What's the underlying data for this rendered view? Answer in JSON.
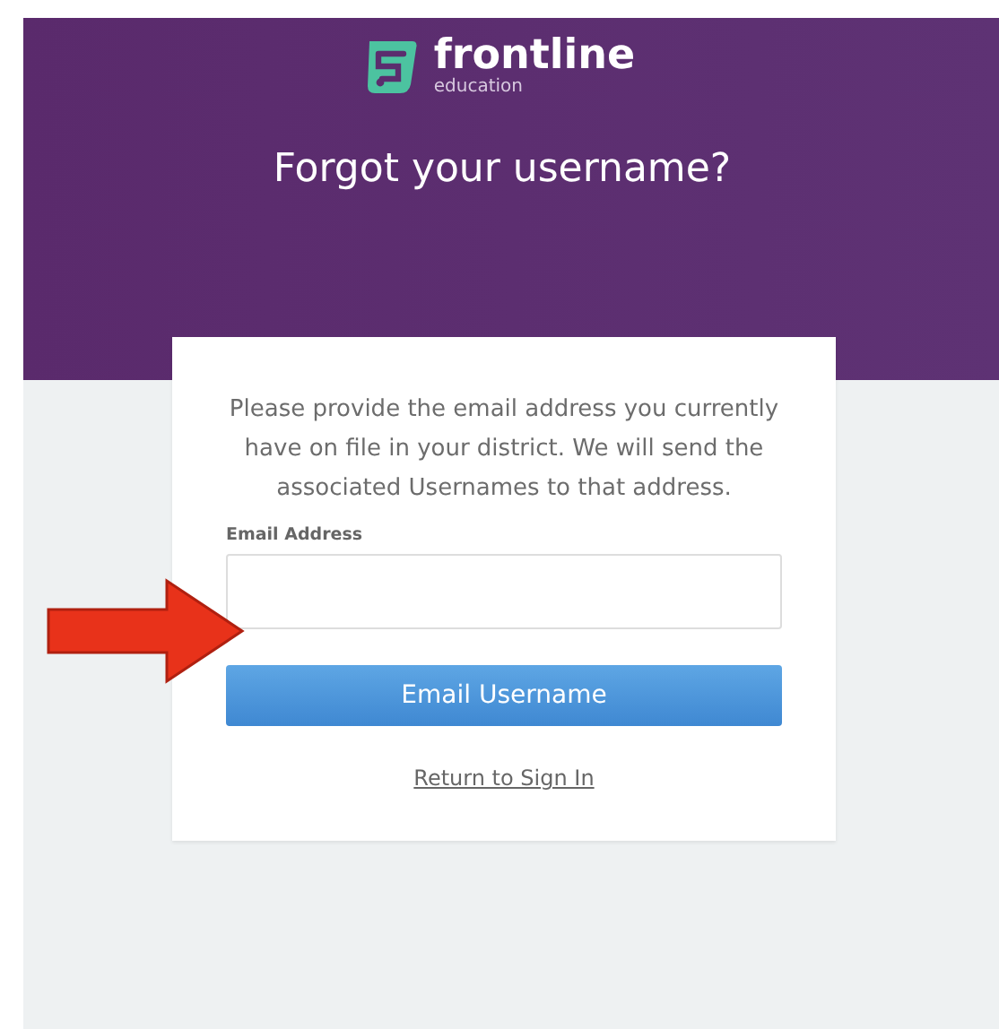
{
  "logo": {
    "name": "frontline",
    "tagline": "education"
  },
  "title": "Forgot your username?",
  "form": {
    "instructions": "Please provide the email address you currently have on file in your district. We will send the associated Usernames to that address.",
    "email_label": "Email Address",
    "submit": "Email Username",
    "return_link": "Return to Sign In"
  },
  "annotation": {
    "kind": "arrow"
  }
}
